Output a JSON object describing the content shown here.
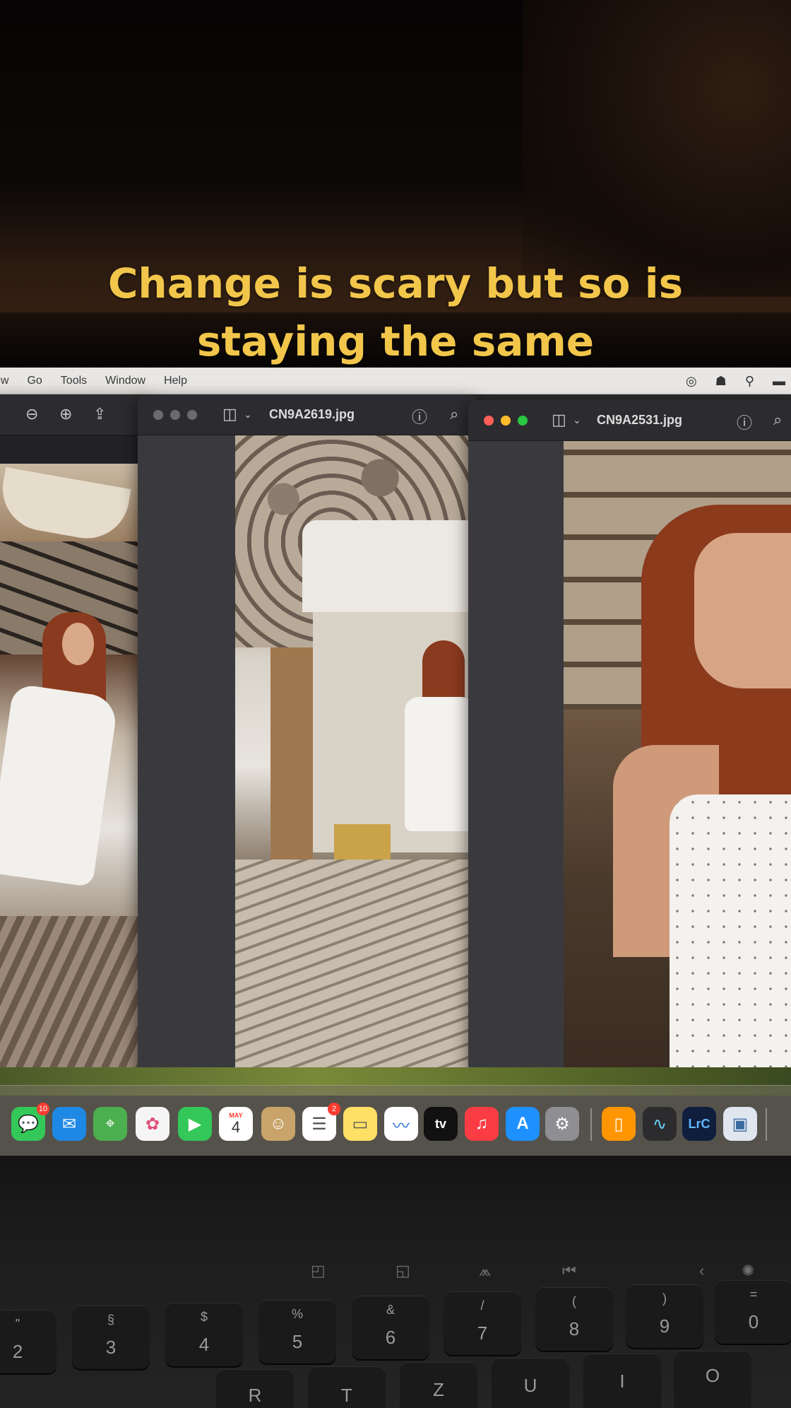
{
  "caption": {
    "line1": "Change is scary but so is",
    "line2": "staying the same"
  },
  "menubar": {
    "items": [
      "ew",
      "Go",
      "Tools",
      "Window",
      "Help"
    ],
    "right_icons": [
      "color-wheel-icon",
      "airplay-icon",
      "user-icon",
      "battery-icon"
    ]
  },
  "windows": {
    "left": {
      "toolbar_icons": [
        "zoom-out-icon",
        "zoom-in-icon",
        "share-icon"
      ]
    },
    "middle": {
      "title": "CN9A2619.jpg"
    },
    "right": {
      "title": "CN9A2531.jpg"
    }
  },
  "dock": {
    "apps": [
      {
        "name": "messages",
        "glyph": "💬",
        "badge": "10",
        "color": "#34c759"
      },
      {
        "name": "mail",
        "glyph": "✉",
        "badge": "",
        "color": "#1e88e5"
      },
      {
        "name": "maps",
        "glyph": "⌖",
        "badge": "",
        "color": "#4caf50"
      },
      {
        "name": "photos",
        "glyph": "✿",
        "badge": "",
        "color": "#f5f5f5"
      },
      {
        "name": "facetime",
        "glyph": "▶",
        "badge": "",
        "color": "#34c759"
      },
      {
        "name": "calendar",
        "glyph": "4",
        "badge": "",
        "color": "#ffffff",
        "label": "MAY"
      },
      {
        "name": "contacts",
        "glyph": "☺",
        "badge": "",
        "color": "#c9a46a"
      },
      {
        "name": "reminders",
        "glyph": "☰",
        "badge": "2",
        "color": "#ffffff"
      },
      {
        "name": "notes",
        "glyph": "▭",
        "badge": "",
        "color": "#ffe066"
      },
      {
        "name": "freeform",
        "glyph": "〰",
        "badge": "",
        "color": "#ffffff"
      },
      {
        "name": "apple-tv",
        "glyph": "tv",
        "badge": "",
        "color": "#111111"
      },
      {
        "name": "music",
        "glyph": "♫",
        "badge": "",
        "color": "#fc3c44"
      },
      {
        "name": "app-store",
        "glyph": "A",
        "badge": "",
        "color": "#1e90ff"
      },
      {
        "name": "system-settings",
        "glyph": "⚙",
        "badge": "",
        "color": "#8e8e93"
      },
      {
        "name": "books",
        "glyph": "▯",
        "badge": "",
        "color": "#ff9500"
      },
      {
        "name": "activity-monitor",
        "glyph": "∿",
        "badge": "",
        "color": "#2c2c2e"
      },
      {
        "name": "lightroom-classic",
        "glyph": "LrC",
        "badge": "",
        "color": "#0f1e3c"
      },
      {
        "name": "preview",
        "glyph": "▣",
        "badge": "",
        "color": "#dfe6ee"
      }
    ]
  },
  "keyboard": {
    "keys": [
      {
        "top": "\"",
        "bottom": "2"
      },
      {
        "top": "§",
        "bottom": "3"
      },
      {
        "top": "$",
        "bottom": "4"
      },
      {
        "top": "%",
        "bottom": "5"
      },
      {
        "top": "&",
        "bottom": "6"
      },
      {
        "top": "/",
        "bottom": "7"
      },
      {
        "top": "(",
        "bottom": "8"
      },
      {
        "top": ")",
        "bottom": "9"
      },
      {
        "top": "=",
        "bottom": "0"
      }
    ],
    "bottom_row": [
      "R",
      "T",
      "Z",
      "U",
      "I",
      "O"
    ]
  }
}
